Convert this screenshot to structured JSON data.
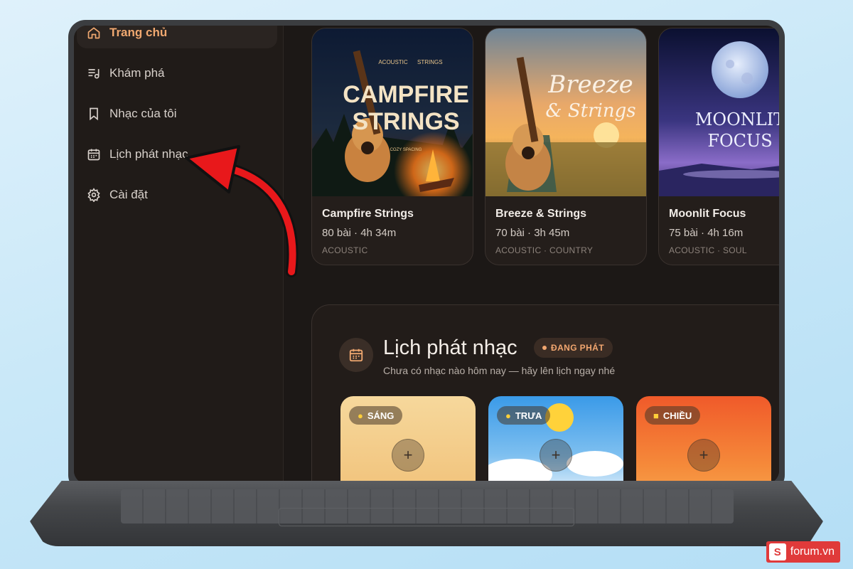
{
  "sidebar": {
    "items": [
      {
        "label": "Trang chủ",
        "icon": "home-icon",
        "active": true
      },
      {
        "label": "Khám phá",
        "icon": "music-list-icon"
      },
      {
        "label": "Nhạc của tôi",
        "icon": "bookmark-icon"
      },
      {
        "label": "Lịch phát nhạc",
        "icon": "calendar-icon"
      },
      {
        "label": "Cài đặt",
        "icon": "gear-icon"
      }
    ]
  },
  "playlists": [
    {
      "title": "Campfire Strings",
      "meta": "80 bài · 4h 34m",
      "tags": "ACOUSTIC",
      "art_line1": "CAMPFIRE",
      "art_line2": "STRINGS",
      "art_kicker": "ACOUSTIC",
      "art_kicker2": "STRINGS",
      "art_footer": "COZY SPACING"
    },
    {
      "title": "Breeze & Strings",
      "meta": "70 bài · 3h 45m",
      "tags": "ACOUSTIC · COUNTRY",
      "art_line1": "Breeze",
      "art_line2": "& Strings"
    },
    {
      "title": "Moonlit Focus",
      "meta": "75 bài · 4h 16m",
      "tags": "ACOUSTIC · SOUL",
      "art_line1": "MOONLIT",
      "art_line2": "FOCUS"
    }
  ],
  "schedule": {
    "title": "Lịch phát nhạc",
    "badge": "ĐANG PHÁT",
    "subtitle": "Chưa có nhạc nào hôm nay — hãy lên lịch ngay nhé",
    "slots": [
      {
        "label": "SÁNG",
        "add": "+"
      },
      {
        "label": "TRƯA",
        "add": "+"
      },
      {
        "label": "CHIỀU",
        "add": "+"
      }
    ]
  },
  "watermark": {
    "logo": "S",
    "text": "forum.vn"
  },
  "colors": {
    "accent": "#f0a870",
    "arrow": "#e8181b",
    "background": "#1c1816"
  }
}
